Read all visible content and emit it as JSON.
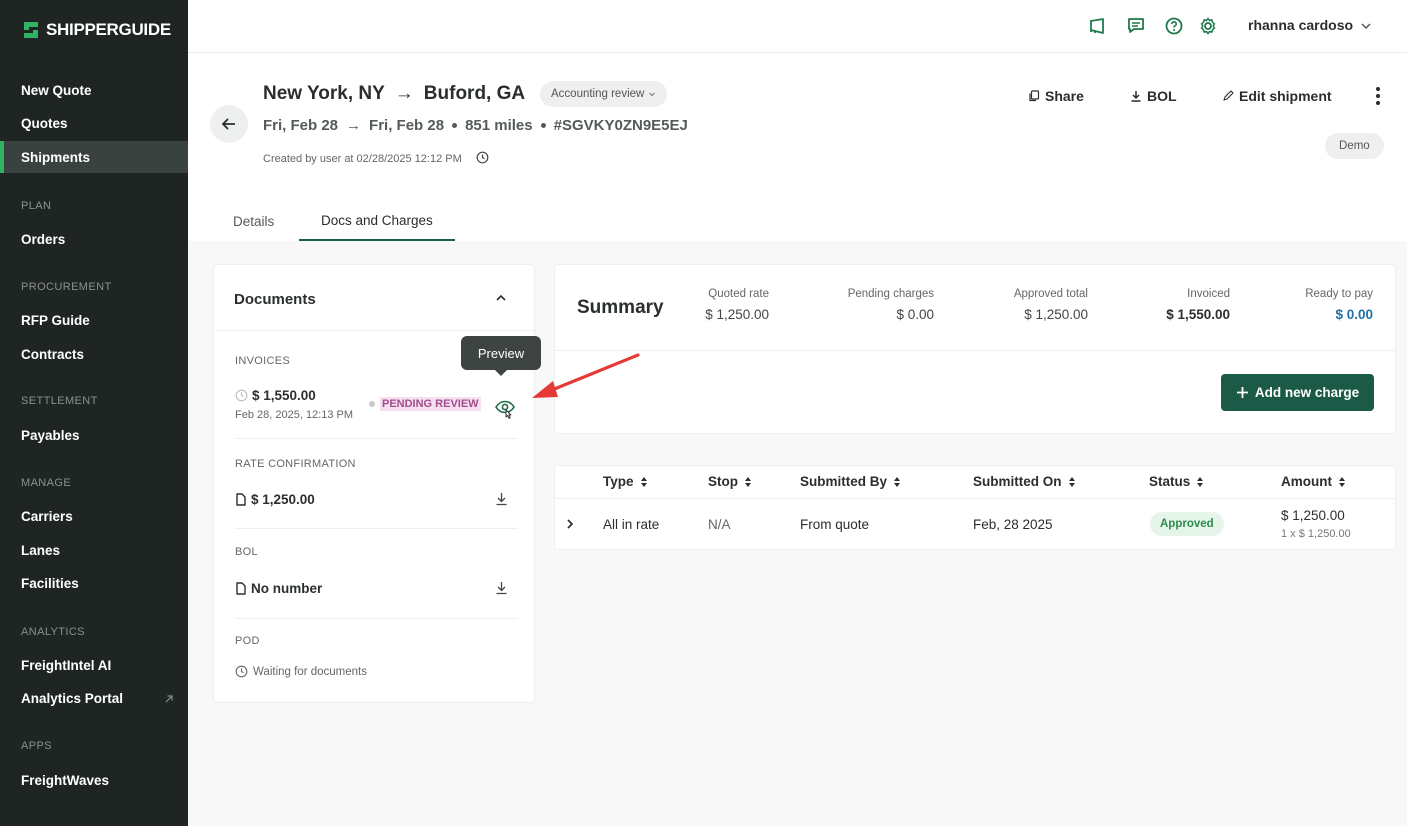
{
  "brand": {
    "name": "SHIPPERGUIDE",
    "logo_color": "#2fb463"
  },
  "sidebar": {
    "items": [
      {
        "label": "New Quote"
      },
      {
        "label": "Quotes"
      },
      {
        "label": "Shipments",
        "active": true
      },
      {
        "label": "Orders"
      },
      {
        "label": "RFP Guide"
      },
      {
        "label": "Contracts"
      },
      {
        "label": "Payables"
      },
      {
        "label": "Carriers"
      },
      {
        "label": "Lanes"
      },
      {
        "label": "Facilities"
      },
      {
        "label": "FreightIntel AI"
      },
      {
        "label": "Analytics Portal"
      },
      {
        "label": "FreightWaves"
      }
    ],
    "sections": [
      "PLAN",
      "PROCUREMENT",
      "SETTLEMENT",
      "MANAGE",
      "ANALYTICS",
      "APPS"
    ]
  },
  "topbar": {
    "icons": [
      "megaphone-icon",
      "chat-icon",
      "help-icon",
      "settings-icon"
    ],
    "user_name": "rhanna cardoso"
  },
  "shipment": {
    "origin": "New York, NY",
    "arrow": "→",
    "destination": "Buford, GA",
    "status_badge": "Accounting review",
    "date_start": "Fri, Feb 28",
    "date_end": "Fri, Feb 28",
    "distance": "851 miles",
    "reference": "#SGVKY0ZN9E5EJ",
    "created": "Created by user at 02/28/2025 12:12 PM",
    "env_badge": "Demo"
  },
  "actions": {
    "share": "Share",
    "bol": "BOL",
    "edit": "Edit shipment"
  },
  "tabs": [
    {
      "label": "Details"
    },
    {
      "label": "Docs and Charges",
      "active": true
    }
  ],
  "documents": {
    "title": "Documents",
    "invoices_label": "INVOICES",
    "invoice_amount": "$ 1,550.00",
    "invoice_date": "Feb 28, 2025, 12:13 PM",
    "invoice_status": "PENDING REVIEW",
    "tooltip": "Preview",
    "rate_label": "RATE CONFIRMATION",
    "rate_amount": "$ 1,250.00",
    "bol_label": "BOL",
    "bol_value": "No number",
    "pod_label": "POD",
    "pod_value": "Waiting for documents"
  },
  "summary": {
    "title": "Summary",
    "quoted_label": "Quoted rate",
    "quoted_value": "$ 1,250.00",
    "pending_label": "Pending charges",
    "pending_value": "$ 0.00",
    "approved_label": "Approved total",
    "approved_value": "$ 1,250.00",
    "invoiced_label": "Invoiced",
    "invoiced_value": "$ 1,550.00",
    "ready_label": "Ready to pay",
    "ready_value": "$ 0.00",
    "add_button": "Add new charge"
  },
  "charges": {
    "columns": [
      "Type",
      "Stop",
      "Submitted By",
      "Submitted On",
      "Status",
      "Amount"
    ],
    "rows": [
      {
        "type": "All in rate",
        "stop": "N/A",
        "submitted_by": "From quote",
        "submitted_on": "Feb, 28 2025",
        "status": "Approved",
        "amount": "$ 1,250.00",
        "amount_detail": "1 x $ 1,250.00"
      }
    ]
  },
  "colors": {
    "sidebar_bg": "#1f2523",
    "primary_button": "#1b5a47",
    "pending_text": "#a24d8c",
    "pending_bg": "#f6dff0",
    "approved_text": "#2e8a4d",
    "annotation_arrow": "#e53935"
  }
}
